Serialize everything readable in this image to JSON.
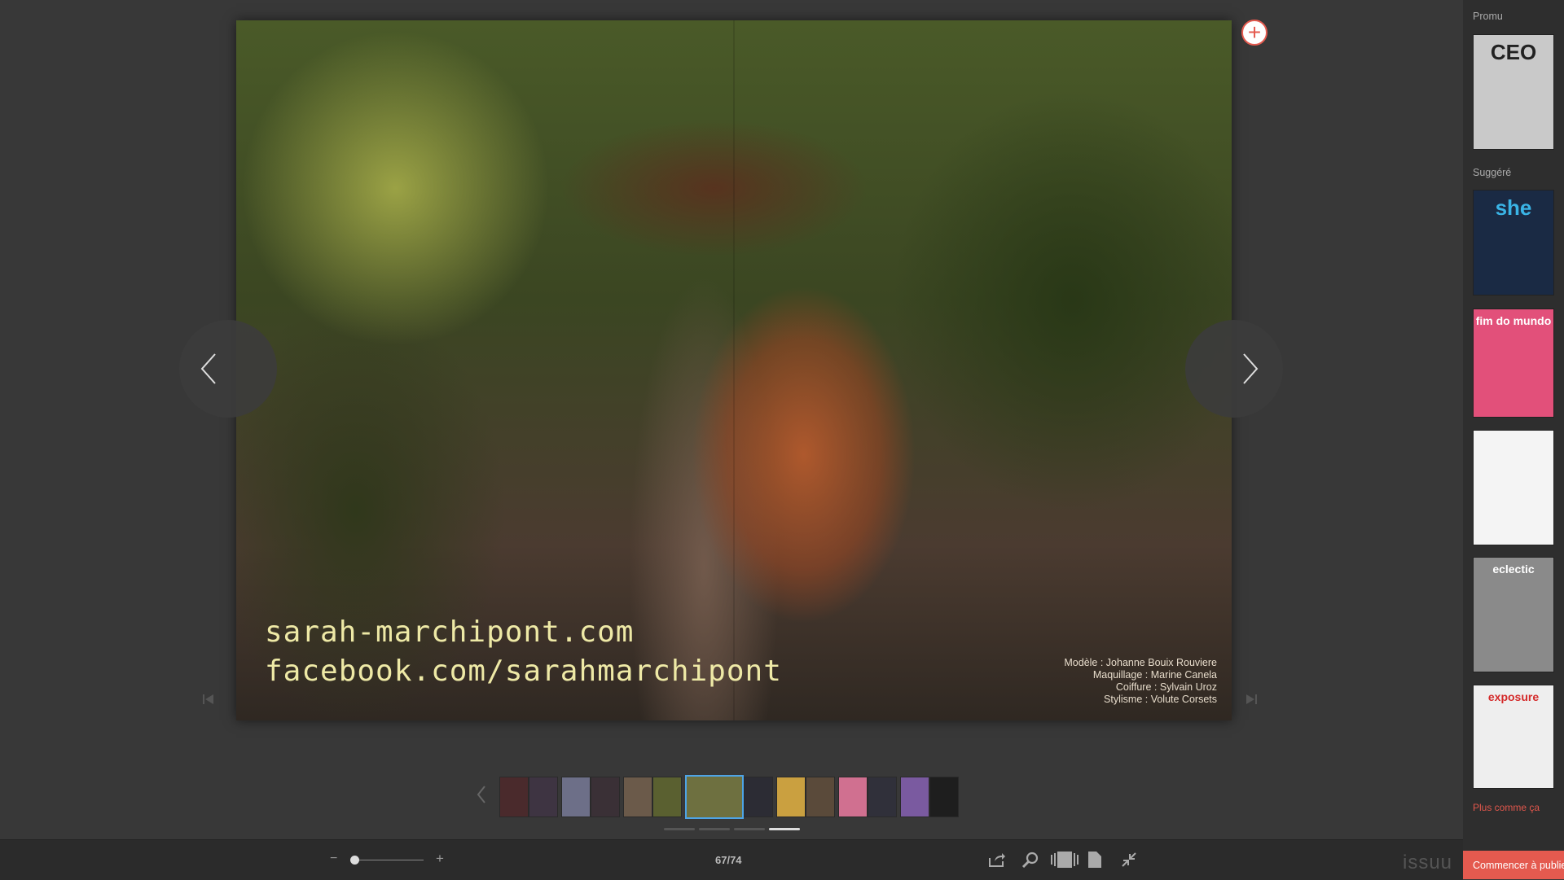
{
  "viewer": {
    "credit_web": [
      "sarah-marchipont.com",
      "facebook.com/sarahmarchipont"
    ],
    "credits": [
      "Modèle : Johanne Bouix Rouviere",
      "Maquillage : Marine Canela",
      "Coiffure : Sylvain Uroz",
      "Stylisme : Volute Corsets"
    ],
    "add_icon": "plus-circle-icon",
    "prev_icon": "chevron-left-icon",
    "next_icon": "chevron-right-icon",
    "first_icon": "skip-first-icon",
    "last_icon": "skip-last-icon"
  },
  "thumbnails": {
    "arrow_icon": "chevron-left-icon",
    "active_index": 6,
    "items": [
      {
        "color": "#4a2a2c"
      },
      {
        "color": "#3e3442"
      },
      {
        "color": "#6d6f88"
      },
      {
        "color": "#3a3036"
      },
      {
        "color": "#6b5a4a"
      },
      {
        "color": "#5a6030"
      },
      {
        "color": "#6e7040"
      },
      {
        "color": "#2c2c34"
      },
      {
        "color": "#caa040"
      },
      {
        "color": "#5a4a3a"
      },
      {
        "color": "#d07090"
      },
      {
        "color": "#30303a"
      },
      {
        "color": "#7a5aa0"
      },
      {
        "color": "#1e1e1e"
      }
    ],
    "pager": {
      "count": 4,
      "current": 4
    }
  },
  "toolbar": {
    "zoom_minus": "−",
    "zoom_plus": "+",
    "zoom_level": 0.0,
    "page_count": "67/74",
    "icons": [
      "share-icon",
      "search-icon",
      "spread-view-icon",
      "single-page-icon",
      "exit-fullscreen-icon"
    ],
    "brand": "issuu"
  },
  "sidebar": {
    "promo_title": "Promu",
    "suggested_title": "Suggéré",
    "more_link": "Plus comme ça",
    "publish_label": "Commencer à publier",
    "covers": [
      {
        "label": "CEO",
        "bg": "#c9c9c9",
        "fg": "#222"
      },
      {
        "label": "she",
        "bg": "#1a2a44",
        "fg": "#3ab4e6"
      },
      {
        "label": "fim do mundo",
        "bg": "#e2507a",
        "fg": "#fff"
      },
      {
        "label": "",
        "bg": "#f4f4f4",
        "fg": "#222"
      },
      {
        "label": "eclectic",
        "bg": "#8a8a8a",
        "fg": "#fff"
      },
      {
        "label": "exposure",
        "bg": "#eeeeee",
        "fg": "#d42a2a"
      }
    ]
  },
  "colors": {
    "accent": "#e45a4f",
    "active_thumb": "#4ea4e6",
    "background": "#383838"
  }
}
